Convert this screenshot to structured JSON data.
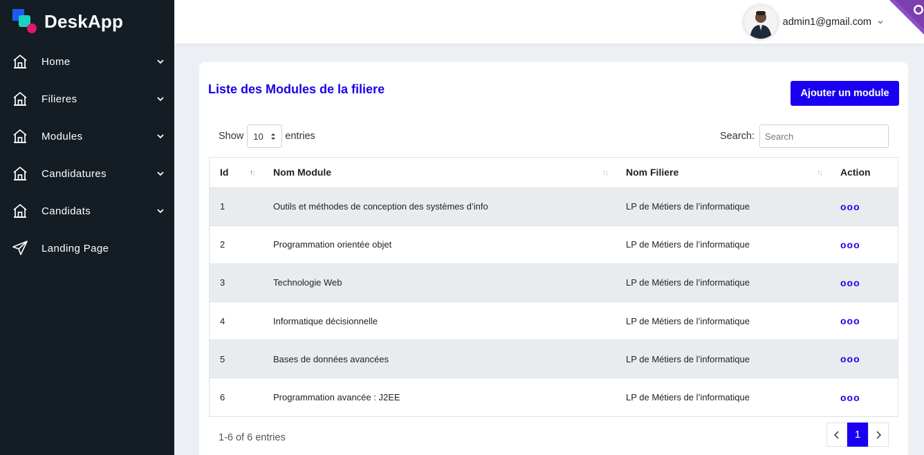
{
  "brand": {
    "name": "DeskApp"
  },
  "sidebar": {
    "items": [
      {
        "label": "Home",
        "icon": "house-icon",
        "has_dropdown": true
      },
      {
        "label": "Filieres",
        "icon": "house-icon",
        "has_dropdown": true
      },
      {
        "label": "Modules",
        "icon": "house-icon",
        "has_dropdown": true
      },
      {
        "label": "Candidatures",
        "icon": "house-icon",
        "has_dropdown": true
      },
      {
        "label": "Candidats",
        "icon": "house-icon",
        "has_dropdown": true
      },
      {
        "label": "Landing Page",
        "icon": "paper-plane-icon",
        "has_dropdown": false
      }
    ]
  },
  "header": {
    "user_email": "admin1@gmail.com"
  },
  "page": {
    "title": "Liste des Modules de la filiere",
    "add_button": "Ajouter un module"
  },
  "table_controls": {
    "show_label": "Show",
    "page_size": "10",
    "entries_label": "entries",
    "search_label": "Search:",
    "search_placeholder": "Search"
  },
  "table": {
    "columns": [
      "Id",
      "Nom Module",
      "Nom Filiere",
      "Action"
    ],
    "rows": [
      {
        "id": "1",
        "module": "Outils et méthodes de conception des systèmes d’info",
        "filiere": "LP de Métiers de l’informatique",
        "action": "ooo"
      },
      {
        "id": "2",
        "module": "Programmation orientée objet",
        "filiere": "LP de Métiers de l’informatique",
        "action": "ooo"
      },
      {
        "id": "3",
        "module": "Technologie Web",
        "filiere": "LP de Métiers de l’informatique",
        "action": "ooo"
      },
      {
        "id": "4",
        "module": "Informatique décisionnelle",
        "filiere": "LP de Métiers de l’informatique",
        "action": "ooo"
      },
      {
        "id": "5",
        "module": "Bases de données avancées",
        "filiere": "LP de Métiers de l’informatique",
        "action": "ooo"
      },
      {
        "id": "6",
        "module": "Programmation avancée : J2EE",
        "filiere": "LP de Métiers de l’informatique",
        "action": "ooo"
      }
    ]
  },
  "footer": {
    "info": "1-6 of 6 entries",
    "current_page": "1"
  },
  "colors": {
    "sidebar_bg": "#141d23",
    "accent": "#1a00f0",
    "title": "#1b00e8",
    "page_bg": "#ecf0f4",
    "stripe": "#e9ecef"
  }
}
